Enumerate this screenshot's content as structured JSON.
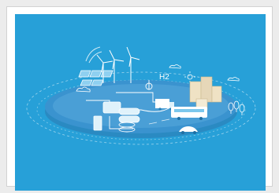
{
  "illustration": {
    "label": "H2",
    "colors": {
      "background": "#27a0d8",
      "platform_outer": "#2f9fd4",
      "platform_inner": "#3d8fcd",
      "line": "#ffffff",
      "building": "#e6d7b8",
      "bus": "#ffffff",
      "car": "#ffffff"
    },
    "icons": [
      "wind-turbine-icon",
      "solar-panel-icon",
      "hydrogen-plant-icon",
      "pipeline-icon",
      "storage-tank-icon",
      "building-icon",
      "bus-icon",
      "car-icon",
      "sun-icon",
      "cloud-icon",
      "tree-icon"
    ]
  }
}
